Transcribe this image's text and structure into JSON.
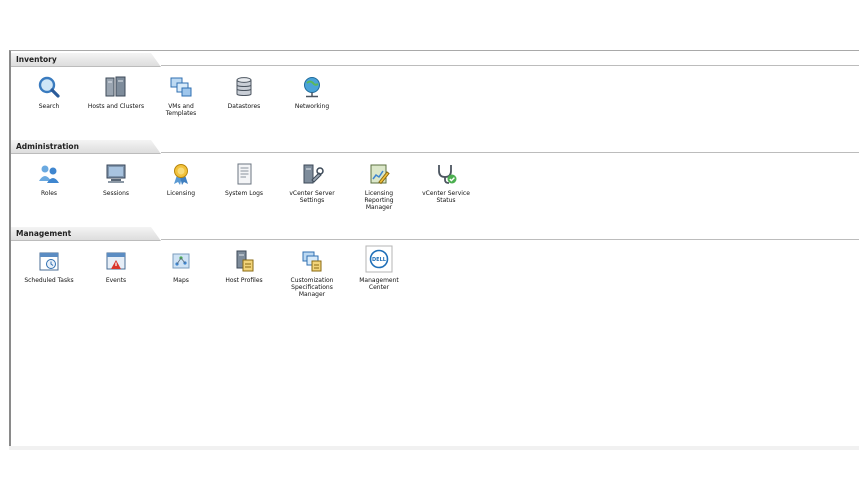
{
  "sections": {
    "inventory": {
      "title": "Inventory",
      "items": [
        {
          "label": "Search",
          "icon": "search-icon"
        },
        {
          "label": "Hosts and Clusters",
          "icon": "hosts-clusters-icon"
        },
        {
          "label": "VMs and\nTemplates",
          "icon": "vms-templates-icon"
        },
        {
          "label": "Datastores",
          "icon": "datastores-icon"
        },
        {
          "label": "Networking",
          "icon": "networking-icon"
        }
      ]
    },
    "administration": {
      "title": "Administration",
      "items": [
        {
          "label": "Roles",
          "icon": "roles-icon"
        },
        {
          "label": "Sessions",
          "icon": "sessions-icon"
        },
        {
          "label": "Licensing",
          "icon": "licensing-icon"
        },
        {
          "label": "System Logs",
          "icon": "system-logs-icon"
        },
        {
          "label": "vCenter Server\nSettings",
          "icon": "vcenter-settings-icon"
        },
        {
          "label": "Licensing\nReporting\nManager",
          "icon": "licensing-reporting-icon"
        },
        {
          "label": "vCenter Service\nStatus",
          "icon": "service-status-icon"
        }
      ]
    },
    "management": {
      "title": "Management",
      "items": [
        {
          "label": "Scheduled Tasks",
          "icon": "scheduled-tasks-icon"
        },
        {
          "label": "Events",
          "icon": "events-icon"
        },
        {
          "label": "Maps",
          "icon": "maps-icon"
        },
        {
          "label": "Host Profiles",
          "icon": "host-profiles-icon"
        },
        {
          "label": "Customization\nSpecifications\nManager",
          "icon": "customization-icon"
        },
        {
          "label": "Management\nCenter",
          "icon": "dell-logo-icon",
          "logo_text": "DELL"
        }
      ]
    }
  }
}
